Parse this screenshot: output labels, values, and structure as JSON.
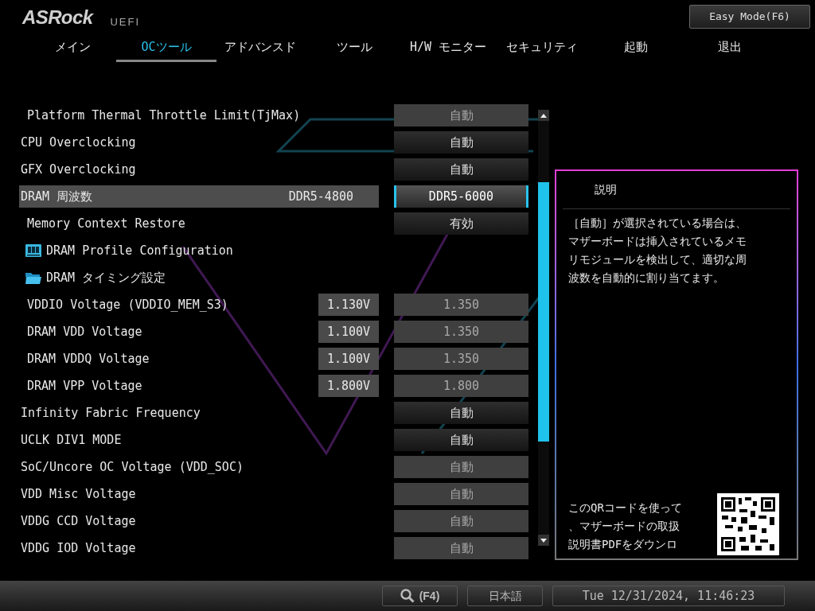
{
  "header": {
    "logo": "ASRock",
    "logo_suffix": "UEFI",
    "easy_mode_button": "Easy Mode(F6)"
  },
  "tabs": [
    {
      "label": "メイン",
      "selected": false
    },
    {
      "label": "OCツール",
      "selected": true
    },
    {
      "label": "アドバンスド",
      "selected": false
    },
    {
      "label": "ツール",
      "selected": false
    },
    {
      "label": "H/W モニター",
      "selected": false
    },
    {
      "label": "セキュリティ",
      "selected": false
    },
    {
      "label": "起動",
      "selected": false
    },
    {
      "label": "退出",
      "selected": false
    }
  ],
  "settings": [
    {
      "kind": "setting",
      "label": "Platform Thermal Throttle Limit(TjMax)",
      "indented": true,
      "value": "自動",
      "disabled": true,
      "selected": false
    },
    {
      "kind": "setting",
      "label": "CPU Overclocking",
      "indented": false,
      "value": "自動",
      "disabled": false,
      "selected": false
    },
    {
      "kind": "setting",
      "label": "GFX Overclocking",
      "indented": false,
      "value": "自動",
      "disabled": false,
      "selected": false
    },
    {
      "kind": "setting",
      "label": "DRAM 周波数",
      "indented": false,
      "current": "DDR5-4800",
      "value": "DDR5-6000",
      "disabled": false,
      "selected": true
    },
    {
      "kind": "setting",
      "label": "Memory Context Restore",
      "indented": true,
      "value": "有効",
      "disabled": false,
      "selected": false
    },
    {
      "kind": "profile",
      "label": "DRAM Profile Configuration",
      "selected": false
    },
    {
      "kind": "folder",
      "label": "DRAM タイミング設定",
      "selected": false
    },
    {
      "kind": "setting",
      "label": "VDDIO Voltage (VDDIO_MEM_S3)",
      "indented": true,
      "current": "1.130V",
      "value": "1.350",
      "disabled": true,
      "selected": false
    },
    {
      "kind": "setting",
      "label": "DRAM VDD Voltage",
      "indented": true,
      "current": "1.100V",
      "value": "1.350",
      "disabled": true,
      "selected": false
    },
    {
      "kind": "setting",
      "label": "DRAM VDDQ Voltage",
      "indented": true,
      "current": "1.100V",
      "value": "1.350",
      "disabled": true,
      "selected": false
    },
    {
      "kind": "setting",
      "label": "DRAM VPP Voltage",
      "indented": true,
      "current": "1.800V",
      "value": "1.800",
      "disabled": true,
      "selected": false
    },
    {
      "kind": "setting",
      "label": "Infinity Fabric Frequency",
      "indented": false,
      "value": "自動",
      "disabled": false,
      "selected": false
    },
    {
      "kind": "setting",
      "label": "UCLK DIV1 MODE",
      "indented": false,
      "value": "自動",
      "disabled": false,
      "selected": false
    },
    {
      "kind": "setting",
      "label": "SoC/Uncore OC Voltage (VDD_SOC)",
      "indented": false,
      "value": "自動",
      "disabled": true,
      "selected": false
    },
    {
      "kind": "setting",
      "label": "VDD Misc Voltage",
      "indented": false,
      "value": "自動",
      "disabled": true,
      "selected": false
    },
    {
      "kind": "setting",
      "label": "VDDG CCD Voltage",
      "indented": false,
      "value": "自動",
      "disabled": true,
      "selected": false
    },
    {
      "kind": "setting",
      "label": "VDDG IOD Voltage",
      "indented": false,
      "value": "自動",
      "disabled": true,
      "selected": false
    }
  ],
  "help_panel": {
    "title": "説明",
    "text_lines": [
      "［自動］が選択されている場合は、",
      "マザーボードは挿入されているメモ",
      "リモジュールを検出して、適切な周",
      "波数を自動的に割り当てます。"
    ],
    "qr_caption_lines": [
      "このQRコードを使って",
      "、マザーボードの取扱",
      "説明書PDFをダウンロ"
    ]
  },
  "status_bar": {
    "search_key": "(F4)",
    "language": "日本語",
    "datetime": "Tue 12/31/2024, 11:46:23"
  }
}
